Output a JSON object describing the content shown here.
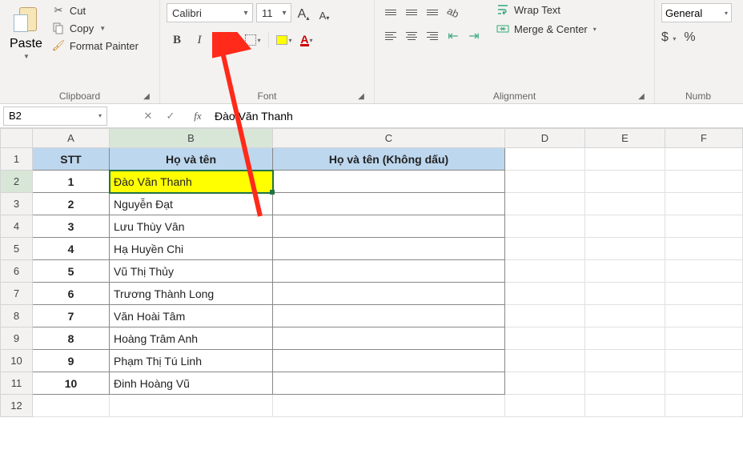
{
  "ribbon": {
    "clipboard": {
      "paste": "Paste",
      "cut": "Cut",
      "copy": "Copy",
      "formatPainter": "Format Painter",
      "group": "Clipboard"
    },
    "font": {
      "fontName": "Calibri",
      "fontSize": "11",
      "group": "Font"
    },
    "alignment": {
      "wrap": "Wrap Text",
      "merge": "Merge & Center",
      "group": "Alignment"
    },
    "number": {
      "format": "General",
      "currency": "$",
      "percent": "%",
      "group": "Numb"
    }
  },
  "formulaBar": {
    "nameBox": "B2",
    "fx": "fx",
    "value": "Đào Văn Thanh"
  },
  "columns": [
    "A",
    "B",
    "C",
    "D",
    "E",
    "F"
  ],
  "headers": {
    "stt": "STT",
    "name": "Họ và tên",
    "noAccent": "Họ và tên (Không dấu)"
  },
  "rows": [
    {
      "stt": "1",
      "name": "Đào Văn Thanh"
    },
    {
      "stt": "2",
      "name": "Nguyễn Đạt"
    },
    {
      "stt": "3",
      "name": "Lưu Thùy Vân"
    },
    {
      "stt": "4",
      "name": "Hạ Huyền Chi"
    },
    {
      "stt": "5",
      "name": "Vũ Thị Thủy"
    },
    {
      "stt": "6",
      "name": "Trương Thành Long"
    },
    {
      "stt": "7",
      "name": "Văn Hoài Tâm"
    },
    {
      "stt": "8",
      "name": "Hoàng Trâm Anh"
    },
    {
      "stt": "9",
      "name": "Phạm Thị Tú Linh"
    },
    {
      "stt": "10",
      "name": "Đinh Hoàng Vũ"
    }
  ],
  "selectedCell": "B2"
}
